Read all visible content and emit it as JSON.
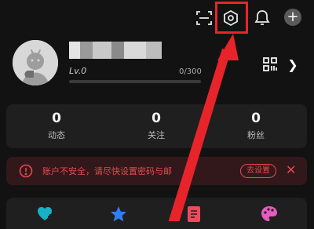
{
  "profile": {
    "level": "Lv.0",
    "progress_text": "0/300",
    "progress_fraction": 0
  },
  "stats": [
    {
      "value": "0",
      "label": "动态"
    },
    {
      "value": "0",
      "label": "关注"
    },
    {
      "value": "0",
      "label": "粉丝"
    }
  ],
  "warning": {
    "text": "账户不安全，请尽快设置密码与邮",
    "button": "去设置"
  },
  "icons": {
    "scan": "scan-icon",
    "settings": "settings-gear-icon",
    "notifications": "bell-icon",
    "add": "add-icon",
    "qr": "qr-code-icon",
    "chevron": "chevron-right-icon",
    "warning": "warning-circle-icon",
    "close": "close-icon",
    "tools": [
      "heart-plus-icon",
      "star-icon",
      "document-icon",
      "palette-icon"
    ]
  },
  "colors": {
    "background": "#121212",
    "card": "#1f1f1f",
    "warning": "#e34a4f",
    "annotation": "#e8242b",
    "tool_teal": "#17b0c6",
    "tool_blue": "#2f7ff2",
    "tool_red": "#ec4b5c",
    "tool_pink": "#e75ac0"
  }
}
